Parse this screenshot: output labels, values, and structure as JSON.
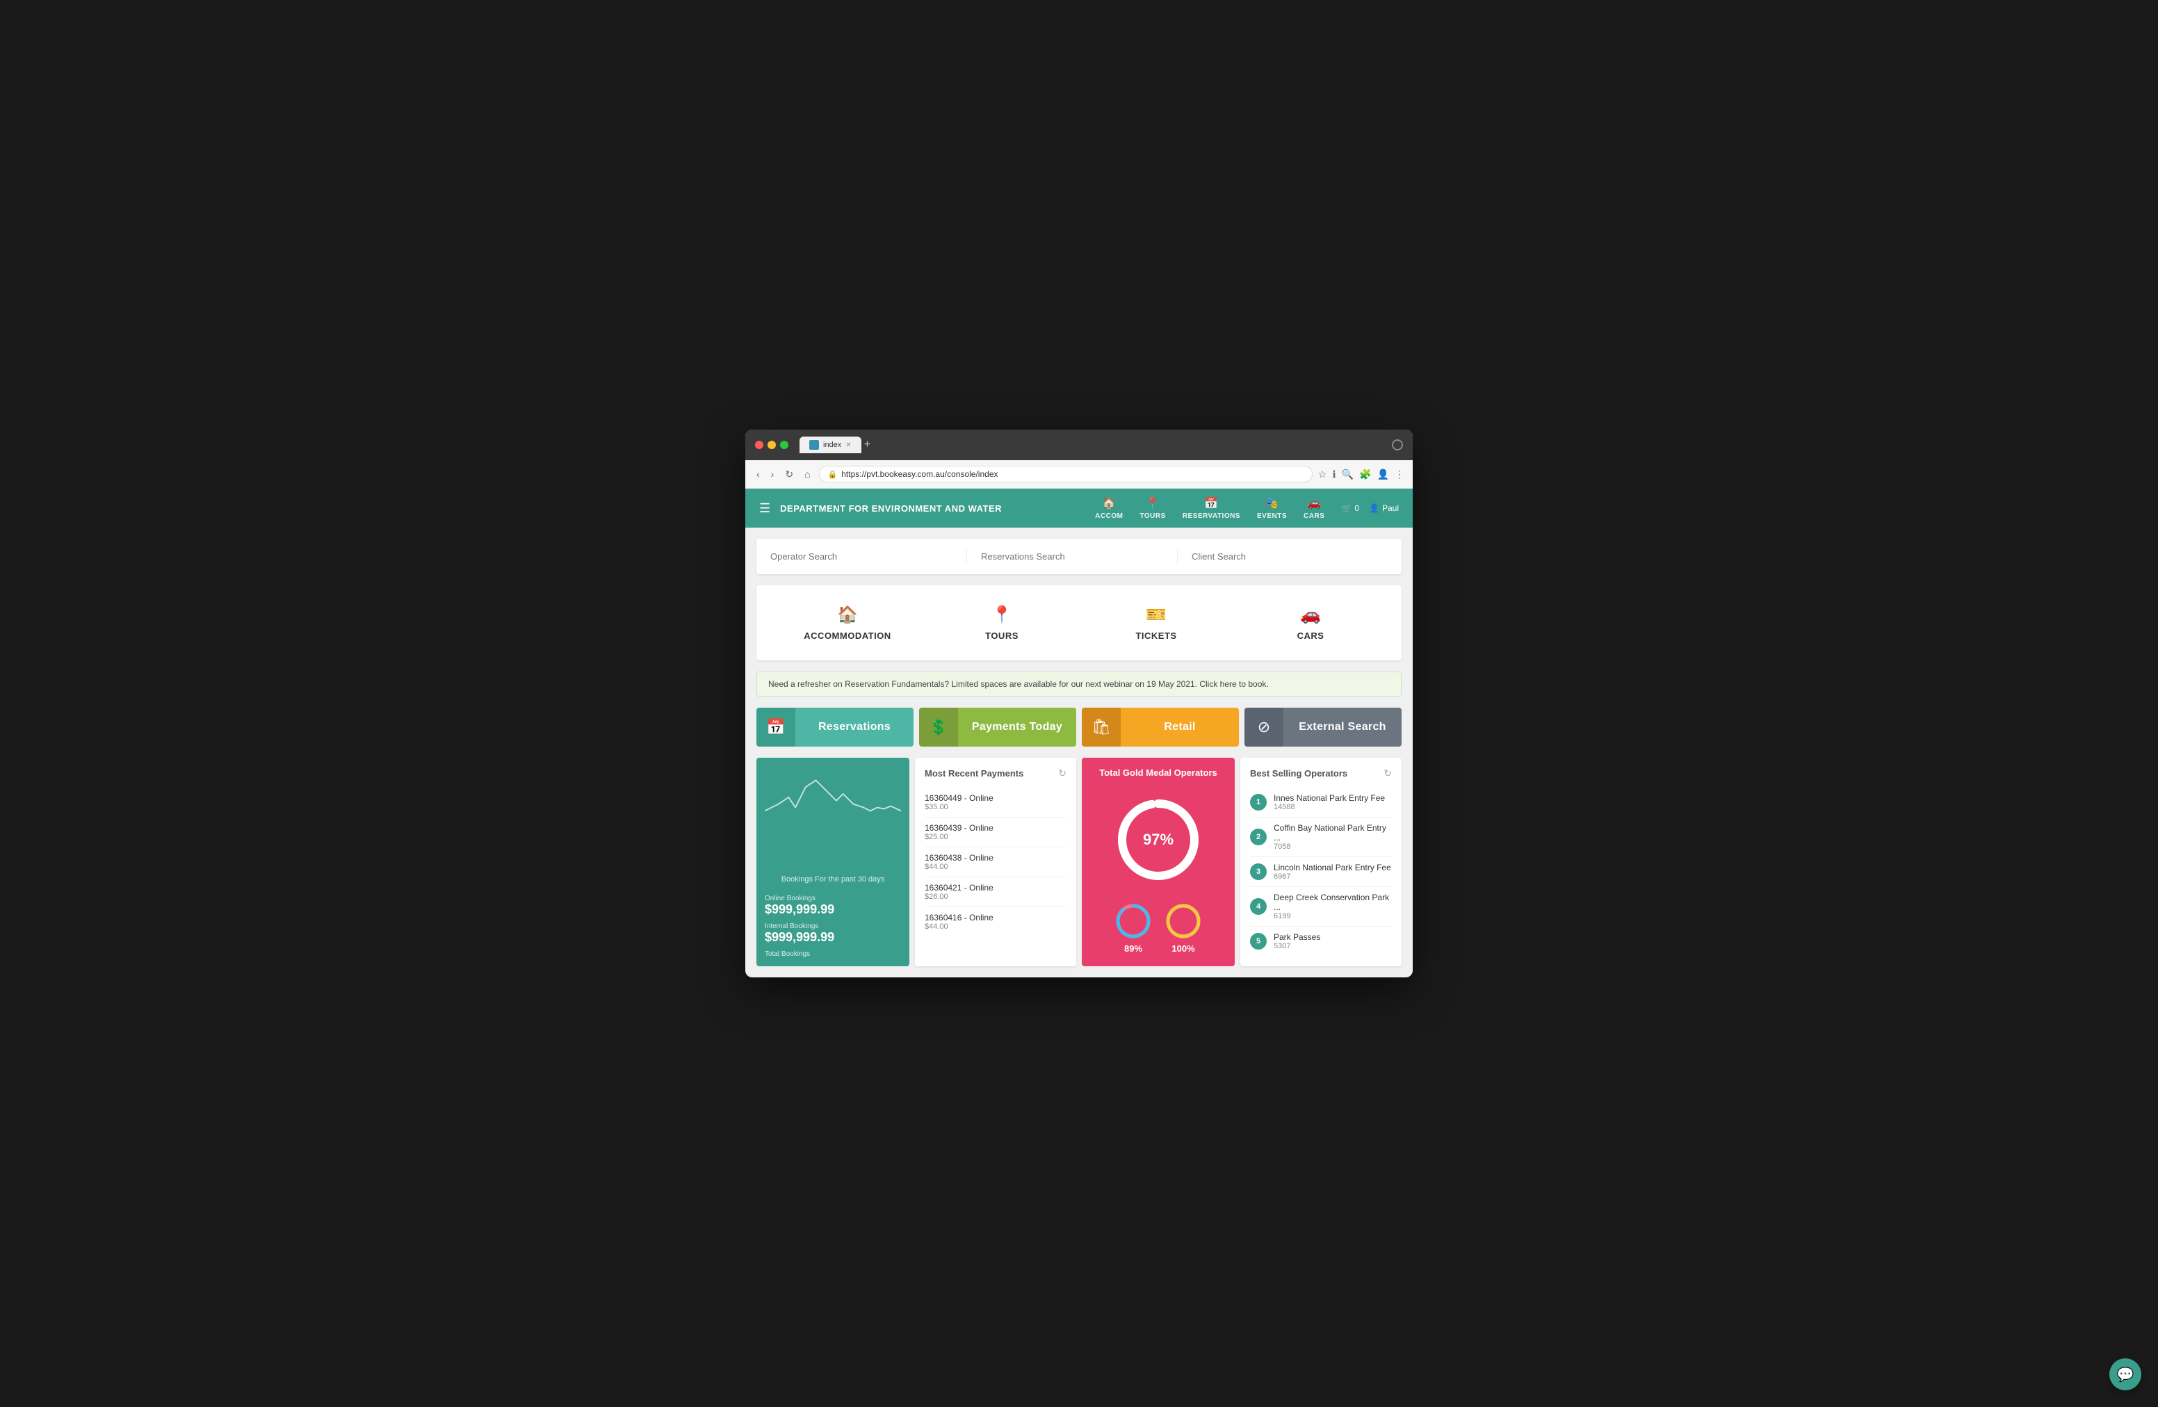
{
  "browser": {
    "tab_title": "index",
    "url": "https://pvt.bookeasy.com.au/console/index",
    "new_tab_label": "+"
  },
  "nav": {
    "hamburger": "☰",
    "brand": "DEPARTMENT FOR ENVIRONMENT AND WATER",
    "items": [
      {
        "id": "accom",
        "icon": "🏠",
        "label": "ACCOM"
      },
      {
        "id": "tours",
        "icon": "📍",
        "label": "TOURS"
      },
      {
        "id": "reservations",
        "icon": "📅",
        "label": "RESERVATIONS"
      },
      {
        "id": "events",
        "icon": "🎫",
        "label": "EVENTS"
      },
      {
        "id": "cars",
        "icon": "🚗",
        "label": "CARS"
      }
    ],
    "cart_count": "0",
    "user_name": "Paul"
  },
  "search": {
    "operator_placeholder": "Operator Search",
    "reservations_placeholder": "Reservations Search",
    "client_placeholder": "Client Search"
  },
  "categories": [
    {
      "id": "accommodation",
      "icon": "🏠",
      "label": "ACCOMMODATION"
    },
    {
      "id": "tours",
      "icon": "📍",
      "label": "TOURS"
    },
    {
      "id": "tickets",
      "icon": "🎫",
      "label": "TICKETS"
    },
    {
      "id": "cars",
      "icon": "🚗",
      "label": "CARS"
    }
  ],
  "alert": {
    "text": "Need a refresher on Reservation Fundamentals? Limited spaces are available for our next webinar on 19 May 2021. Click here to book."
  },
  "action_buttons": [
    {
      "id": "reservations",
      "icon": "📅",
      "label": "Reservations"
    },
    {
      "id": "payments",
      "icon": "💲",
      "label": "Payments Today"
    },
    {
      "id": "retail",
      "icon": "🛍",
      "label": "Retail"
    },
    {
      "id": "external",
      "icon": "⊘",
      "label": "External Search"
    }
  ],
  "bookings_card": {
    "chart_label": "Bookings For the past 30 days",
    "online_label": "Online Bookings",
    "online_value": "$999,999.99",
    "internal_label": "Internal Bookings",
    "internal_value": "$999,999.99",
    "total_label": "Total Bookings"
  },
  "payments_card": {
    "title": "Most Recent Payments",
    "payments": [
      {
        "name": "16360449 - Online",
        "amount": "$35.00"
      },
      {
        "name": "16360439 - Online",
        "amount": "$25.00"
      },
      {
        "name": "16360438 - Online",
        "amount": "$44.00"
      },
      {
        "name": "16360421 - Online",
        "amount": "$26.00"
      },
      {
        "name": "16360416 - Online",
        "amount": "$44.00"
      }
    ]
  },
  "gold_medal": {
    "title": "Total Gold Medal Operators",
    "percentage": "97%",
    "small_charts": [
      {
        "label": "89%",
        "color": "#4db8e8"
      },
      {
        "label": "100%",
        "color": "#f5c842"
      }
    ]
  },
  "best_sellers": {
    "title": "Best Selling Operators",
    "items": [
      {
        "rank": "1",
        "name": "Innes National Park Entry Fee",
        "count": "14588"
      },
      {
        "rank": "2",
        "name": "Coffin Bay National Park Entry ...",
        "count": "7058"
      },
      {
        "rank": "3",
        "name": "Lincoln National Park Entry Fee",
        "count": "6967"
      },
      {
        "rank": "4",
        "name": "Deep Creek Conservation Park ...",
        "count": "6199"
      },
      {
        "rank": "5",
        "name": "Park Passes",
        "count": "5307"
      }
    ]
  },
  "colors": {
    "teal": "#3a9e8d",
    "olive": "#8fba42",
    "orange": "#f5a623",
    "slate": "#6b7580",
    "pink": "#e83e6c"
  }
}
